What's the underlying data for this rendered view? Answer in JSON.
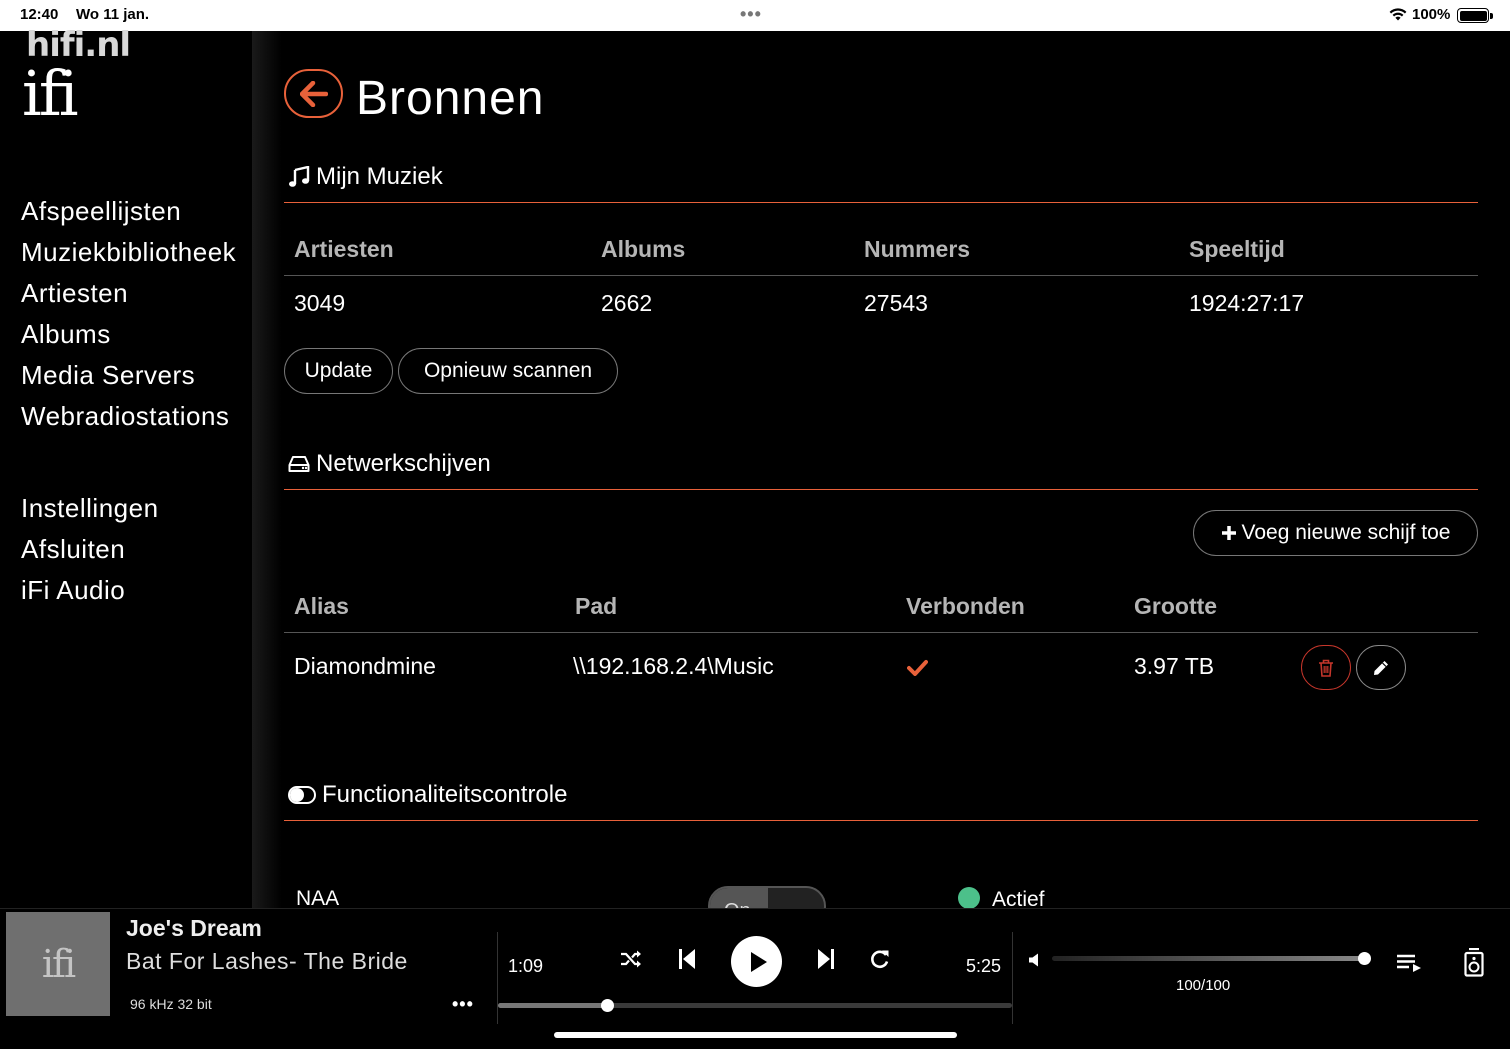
{
  "status_bar": {
    "time": "12:40",
    "date": "Wo 11 jan.",
    "battery_percent": "100%"
  },
  "sidebar": {
    "watermark": "hifi.nl",
    "logo": "ifi",
    "nav_items": [
      {
        "label": "Afspeellijsten"
      },
      {
        "label": "Muziekbibliotheek"
      },
      {
        "label": "Artiesten"
      },
      {
        "label": "Albums"
      },
      {
        "label": "Media Servers"
      },
      {
        "label": "Webradiostations"
      }
    ],
    "secondary_items": [
      {
        "label": "Instellingen"
      },
      {
        "label": "Afsluiten"
      },
      {
        "label": "iFi Audio"
      }
    ]
  },
  "page": {
    "title": "Bronnen",
    "accent_color": "#e8613a"
  },
  "my_music": {
    "heading": "Mijn Muziek",
    "headers": [
      "Artiesten",
      "Albums",
      "Nummers",
      "Speeltijd"
    ],
    "values": [
      "3049",
      "2662",
      "27543",
      "1924:27:17"
    ],
    "update_label": "Update",
    "rescan_label": "Opnieuw scannen"
  },
  "network_drives": {
    "heading": "Netwerkschijven",
    "add_label": "Voeg nieuwe schijf toe",
    "headers": [
      "Alias",
      "Pad",
      "Verbonden",
      "Grootte"
    ],
    "rows": [
      {
        "alias": "Diamondmine",
        "path": "\\\\192.168.2.4\\Music",
        "connected": true,
        "size": "3.97 TB"
      }
    ]
  },
  "functionality": {
    "heading": "Functionaliteitscontrole",
    "rows": [
      {
        "name": "NAA",
        "toggle_label": "On",
        "status": "Actief",
        "status_color": "#4cc08a"
      }
    ]
  },
  "player": {
    "art_label": "ifi",
    "track_title": "Joe's Dream",
    "track_artist": "Bat For Lashes- The Bride",
    "format": "96 kHz 32 bit",
    "more": "•••",
    "elapsed": "1:09",
    "duration": "5:25",
    "progress_fraction": 0.212,
    "volume_fraction": 1.0,
    "volume_text": "100/100"
  }
}
